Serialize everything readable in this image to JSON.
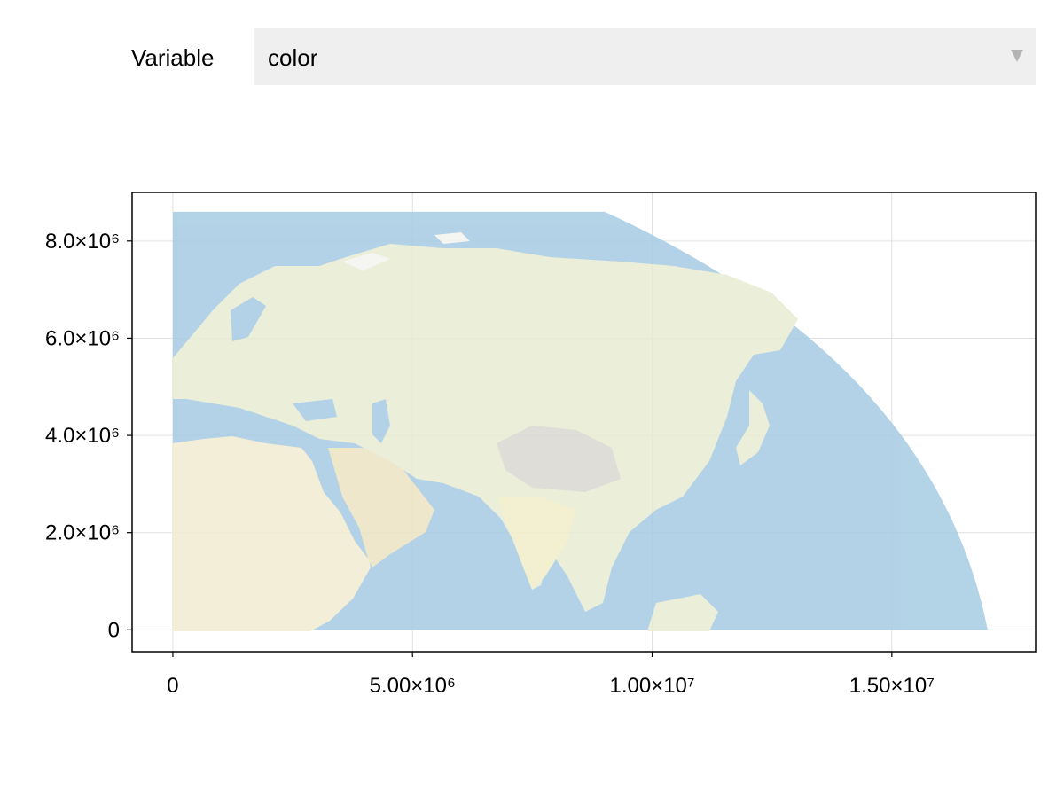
{
  "controls": {
    "variable_label": "Variable",
    "variable_value": "color",
    "dropdown_arrow_icon": "triangle-down-icon"
  },
  "chart_data": {
    "type": "map",
    "content": "Eurasia, Africa and western Pacific basemap imagery (natural-earth style, semi-transparent) in projected coordinates",
    "xlim": [
      -850000,
      18000000
    ],
    "ylim": [
      -450000,
      9000000
    ],
    "extent": {
      "x": [
        0,
        17000000
      ],
      "y": [
        0,
        8600000
      ]
    },
    "grid": true,
    "x_ticks": [
      {
        "value": 0,
        "label": "0"
      },
      {
        "value": 5000000,
        "label": "5.00×10⁶"
      },
      {
        "value": 10000000,
        "label": "1.00×10⁷"
      },
      {
        "value": 15000000,
        "label": "1.50×10⁷"
      }
    ],
    "y_ticks": [
      {
        "value": 0,
        "label": "0"
      },
      {
        "value": 2000000,
        "label": "2.0×10⁶"
      },
      {
        "value": 4000000,
        "label": "4.0×10⁶"
      },
      {
        "value": 6000000,
        "label": "6.0×10⁶"
      },
      {
        "value": 8000000,
        "label": "8.0×10⁶"
      }
    ],
    "colors": {
      "ocean": "#a6cbe3",
      "land": "#eef0d6",
      "grid": "#e0e0e0",
      "axis": "#000000"
    }
  }
}
